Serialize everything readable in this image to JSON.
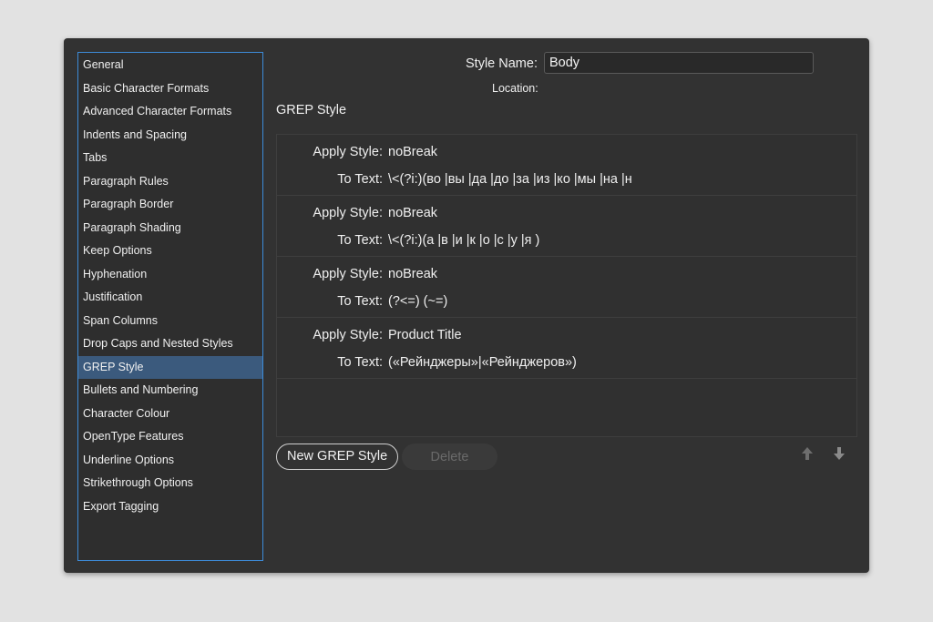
{
  "sidebar": {
    "items": [
      {
        "label": "General"
      },
      {
        "label": "Basic Character Formats"
      },
      {
        "label": "Advanced Character Formats"
      },
      {
        "label": "Indents and Spacing"
      },
      {
        "label": "Tabs"
      },
      {
        "label": "Paragraph Rules"
      },
      {
        "label": "Paragraph Border"
      },
      {
        "label": "Paragraph Shading"
      },
      {
        "label": "Keep Options"
      },
      {
        "label": "Hyphenation"
      },
      {
        "label": "Justification"
      },
      {
        "label": "Span Columns"
      },
      {
        "label": "Drop Caps and Nested Styles"
      },
      {
        "label": "GREP Style"
      },
      {
        "label": "Bullets and Numbering"
      },
      {
        "label": "Character Colour"
      },
      {
        "label": "OpenType Features"
      },
      {
        "label": "Underline Options"
      },
      {
        "label": "Strikethrough Options"
      },
      {
        "label": "Export Tagging"
      }
    ],
    "selected": "GREP Style"
  },
  "header": {
    "style_name_label": "Style Name:",
    "style_name_value": "Body",
    "location_label": "Location:"
  },
  "section": {
    "title": "GREP Style"
  },
  "grep": {
    "apply_label": "Apply Style:",
    "to_text_label": "To Text:",
    "entries": [
      {
        "style": "noBreak",
        "text": "\\<(?i:)(во |вы |да |до |за |из |ко |мы |на |н"
      },
      {
        "style": "noBreak",
        "text": "\\<(?i:)(а |в |и |к |о |с |у |я )"
      },
      {
        "style": "noBreak",
        "text": "(?<=) (~=)"
      },
      {
        "style": "Product Title",
        "text": "(«Рейнджеры»|«Рейнджеров»)"
      }
    ]
  },
  "buttons": {
    "new_label": "New GREP Style",
    "delete_label": "Delete"
  },
  "icons": {
    "move_up": "arrow-up-icon",
    "move_down": "arrow-down-icon"
  },
  "colors": {
    "selection": "#3b5a7d",
    "focus_border": "#3d8bd8",
    "dialog_bg": "#323232"
  }
}
